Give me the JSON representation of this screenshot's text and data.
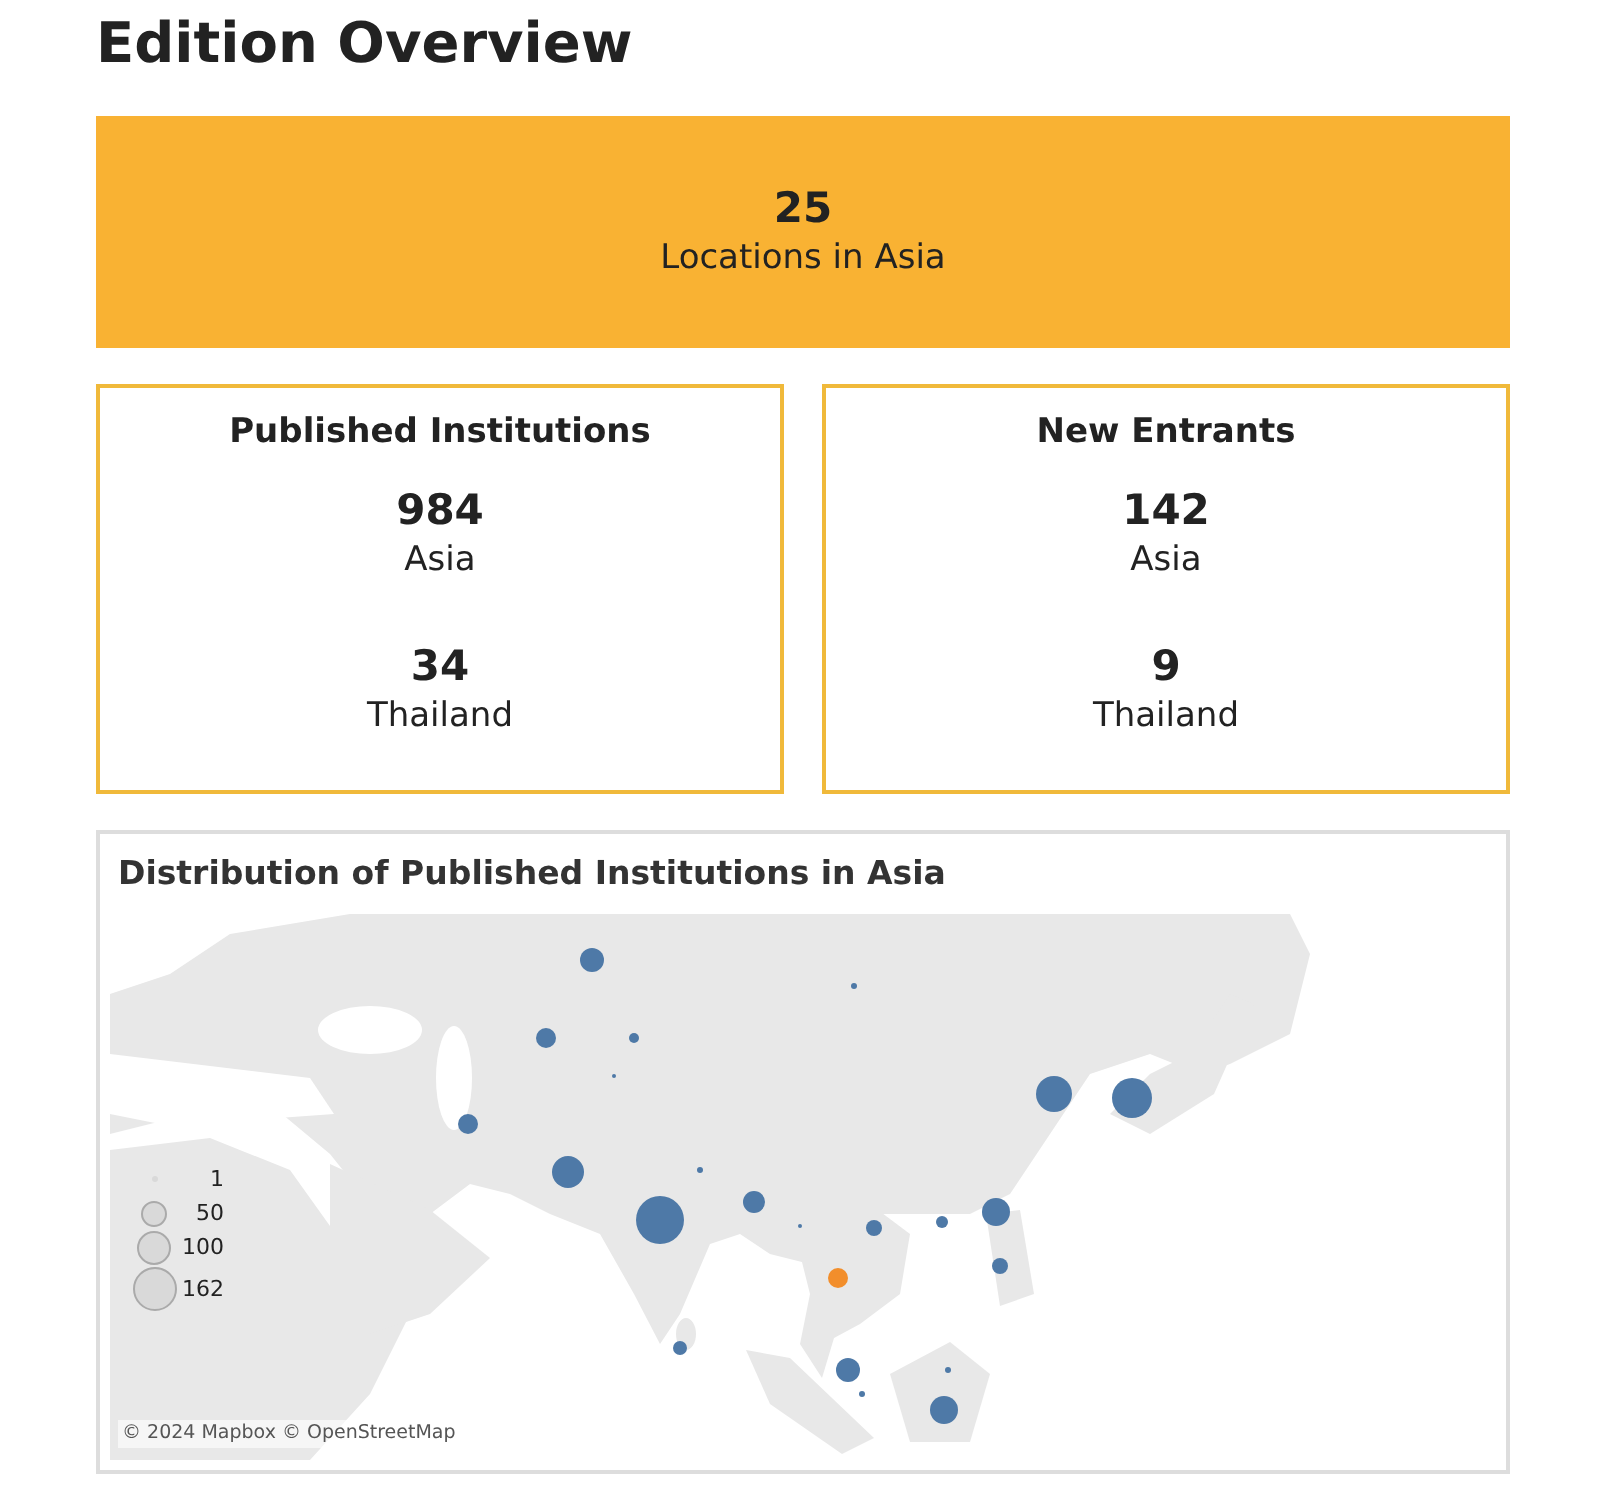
{
  "title": "Edition Overview",
  "banner": {
    "value": "25",
    "label": "Locations in Asia"
  },
  "cards": [
    {
      "title": "Published Institutions",
      "stats": [
        {
          "value": "984",
          "label": "Asia"
        },
        {
          "value": "34",
          "label": "Thailand"
        }
      ]
    },
    {
      "title": "New Entrants",
      "stats": [
        {
          "value": "142",
          "label": "Asia"
        },
        {
          "value": "9",
          "label": "Thailand"
        }
      ]
    }
  ],
  "map": {
    "title": "Distribution of Published Institutions in Asia",
    "legend": [
      "1",
      "50",
      "100",
      "162"
    ],
    "attribution": "© 2024 Mapbox © OpenStreetMap"
  }
}
